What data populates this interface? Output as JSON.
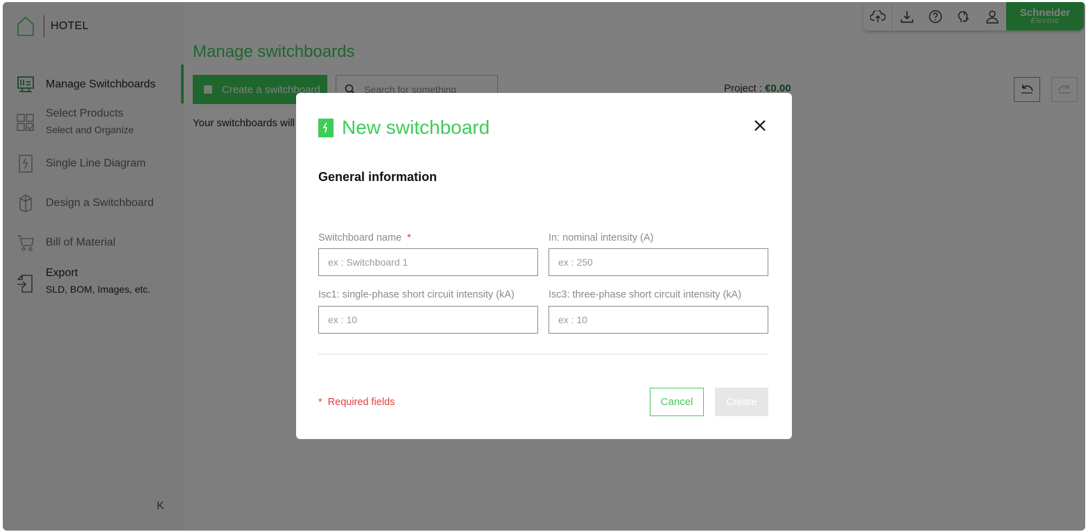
{
  "app": {
    "project_name": "HOTEL",
    "brand_line1": "Schneider",
    "brand_line2": "Electric"
  },
  "sidebar": {
    "items": [
      {
        "icon": "switchboard-icon",
        "label": "Manage Switchboards",
        "sub": "",
        "active": true
      },
      {
        "icon": "products-grid-icon",
        "label": "Select Products",
        "sub": "Select and Organize"
      },
      {
        "icon": "single-line-diagram-icon",
        "label": "Single Line Diagram",
        "sub": ""
      },
      {
        "icon": "cabinet-icon",
        "label": "Design a Switchboard",
        "sub": ""
      },
      {
        "icon": "cart-icon",
        "label": "Bill of Material",
        "sub": ""
      },
      {
        "icon": "export-icon",
        "label": "Export",
        "sub": "SLD, BOM, Images, etc."
      }
    ],
    "collapse_glyph": "K"
  },
  "main": {
    "title": "Manage switchboards",
    "create_label": "Create a switchboard",
    "search_placeholder": "Search for something",
    "project_label": "Project : ",
    "project_value": "€0.00",
    "empty_message": "Your switchboards will a"
  },
  "topbar": {
    "icons": [
      "cloud-upload-icon",
      "download-icon",
      "help-icon",
      "feedback-icon",
      "user-icon"
    ]
  },
  "modal": {
    "title": "New switchboard",
    "section": "General information",
    "fields": {
      "name_label": "Switchboard name",
      "name_required": "*",
      "name_placeholder": "ex : Switchboard 1",
      "in_label": "In: nominal intensity (A)",
      "in_placeholder": "ex : 250",
      "isc1_label": "Isc1: single-phase short circuit intensity (kA)",
      "isc1_placeholder": "ex : 10",
      "isc3_label": "Isc3: three-phase short circuit intensity (kA)",
      "isc3_placeholder": "ex : 10"
    },
    "required_star": "*",
    "required_text": "Required fields",
    "cancel_label": "Cancel",
    "create_label": "Create"
  },
  "colors": {
    "accent": "#3dcd58",
    "required": "#e23b3b",
    "overlay": "rgba(0,0,0,0.5)"
  }
}
